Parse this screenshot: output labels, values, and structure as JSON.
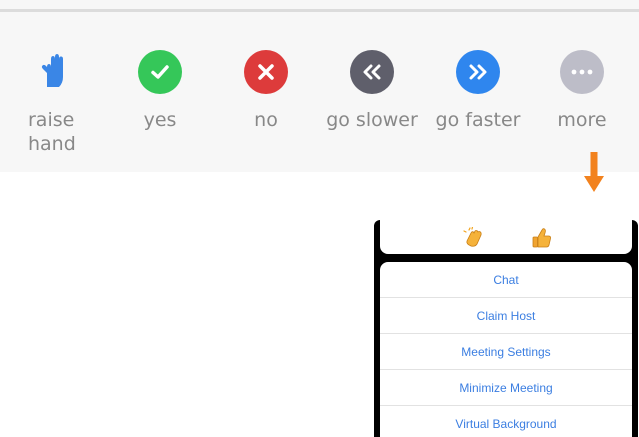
{
  "toolbar": {
    "buttons": [
      {
        "label_1": "raise",
        "label_2": "hand"
      },
      {
        "label": "yes"
      },
      {
        "label": "no"
      },
      {
        "label": "go slower"
      },
      {
        "label": "go faster"
      },
      {
        "label": "more"
      }
    ]
  },
  "colors": {
    "raise_hand": "#3a86e6",
    "yes": "#35c759",
    "no": "#dd3b3b",
    "go_slower": "#5f5f6b",
    "go_faster": "#2f86ee",
    "more": "#bdbdc8",
    "arrow": "#f2821e",
    "menu_text": "#3b7ee1"
  },
  "reactions": [
    "clapping-hands",
    "thumbs-up"
  ],
  "menu": {
    "items": [
      "Chat",
      "Claim Host",
      "Meeting Settings",
      "Minimize Meeting",
      "Virtual Background"
    ]
  }
}
